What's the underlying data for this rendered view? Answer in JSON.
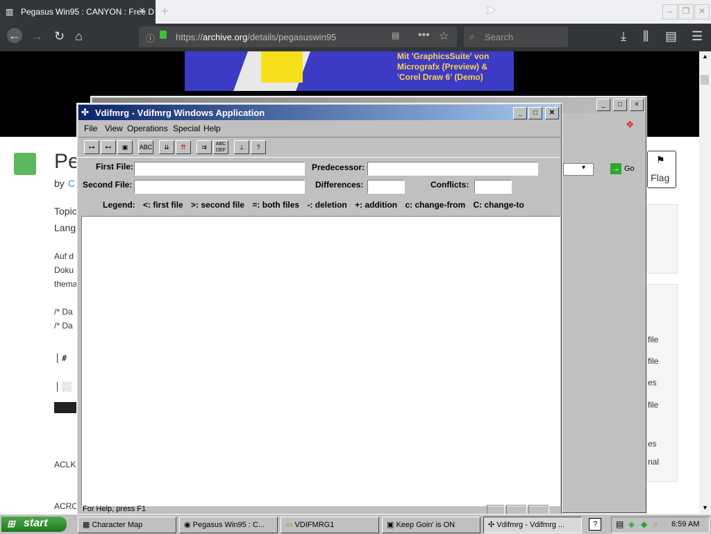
{
  "browser": {
    "tab_title": "Pegasus Win95 : CANYON : Free D",
    "url_prefix": "https://",
    "url_domain": "archive.org",
    "url_path": "/details/pegasuswin95",
    "search_placeholder": "Search"
  },
  "page": {
    "banner_text": "Mit 'GraphicsSuite' von\nMicrografx (Preview) &\n'Corel Draw 6' (Demo)",
    "title_partial": "Pe",
    "by_label": "by",
    "by_link_partial": "C",
    "lines": [
      "Topic",
      "Lang",
      "Auf d",
      "Doku",
      "thema",
      "/* Da",
      "/* Da"
    ],
    "ascii_cells": [
      "# ",
      "░░",
      "▓▓"
    ],
    "bottom_lines": [
      "ACLK",
      "ACRO"
    ],
    "go_label": "Go",
    "flag_label": "Flag",
    "sidebar_frag": [
      "file",
      "file",
      "es",
      "file",
      "es",
      "nal"
    ]
  },
  "vdifmrg": {
    "title": "Vdifmrg - Vdifmrg Windows Application",
    "menu": [
      "File",
      "View",
      "Operations",
      "Special",
      "Help"
    ],
    "tools": [
      "⊶",
      "⊷",
      "▣",
      "ABC",
      "⇊",
      "⇈",
      "⇉",
      "ABC DEF",
      "⊥",
      "?"
    ],
    "first_file_label": "First File:",
    "second_file_label": "Second File:",
    "predecessor_label": "Predecessor:",
    "differences_label": "Differences:",
    "conflicts_label": "Conflicts:",
    "legend": [
      "Legend:",
      "<: first file",
      ">: second file",
      "=: both files",
      "-: deletion",
      "+: addition",
      "c: change-from",
      "C: change-to"
    ],
    "status": "For Help, press F1"
  },
  "taskbar": {
    "start": "start",
    "items": [
      "Character Map",
      "Pegasus Win95 : C...",
      "VDIFMRG1",
      "Keep Goin' is ON",
      "Vdifmrg - Vdifmrg ..."
    ],
    "clock": "6:59 AM"
  }
}
